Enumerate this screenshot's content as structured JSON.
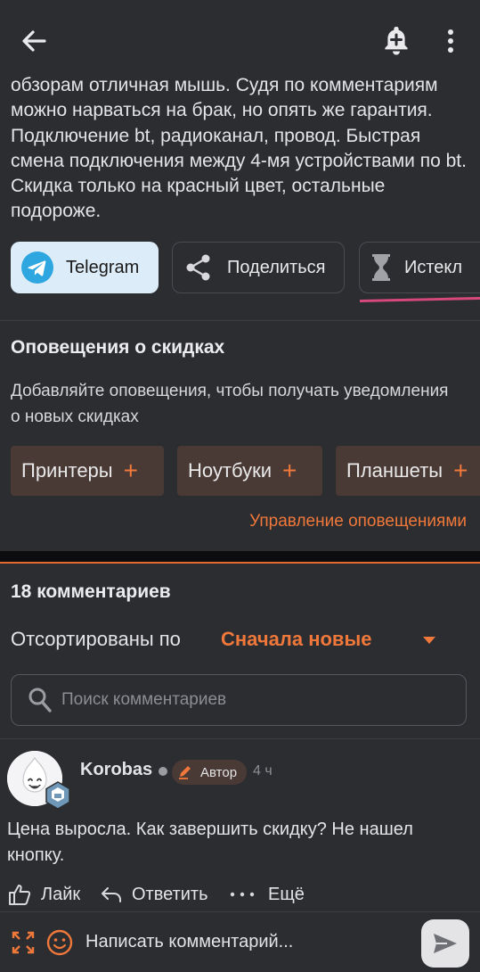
{
  "post": {
    "description": "обзорам отличная мышь. Судя по комментариям можно нарваться на брак, но опять же гарантия. Подключение bt, радиоканал, провод. Быстрая смена подключения между 4-мя устройствами по bt. Скидка только на красный цвет, остальные подороже."
  },
  "share": {
    "telegram": "Telegram",
    "share": "Поделиться",
    "expired": "Истекл"
  },
  "alerts": {
    "title": "Оповещения о скидках",
    "description": "Добавляйте оповещения, чтобы получать уведомления о новых скидках",
    "tags": [
      "Принтеры",
      "Ноутбуки",
      "Планшеты"
    ],
    "plus": "+",
    "manage": "Управление оповещениями"
  },
  "comments": {
    "count": "18 комментариев",
    "sort_label": "Отсортированы по",
    "sort_value": "Сначала новые",
    "search_placeholder": "Поиск комментариев",
    "items": [
      {
        "author": "Korobas",
        "badge": "Автор",
        "time": "4 ч",
        "text": "Цена выросла. Как завершить скидку? Не нашел кнопку.",
        "like": "Лайк",
        "reply": "Ответить",
        "more": "Ещё"
      }
    ]
  },
  "composer": {
    "placeholder": "Написать комментарий..."
  },
  "colors": {
    "accent": "#f0783a",
    "background": "#2b2d31",
    "telegram": "#2ea6e0",
    "pink": "#d8497b"
  }
}
